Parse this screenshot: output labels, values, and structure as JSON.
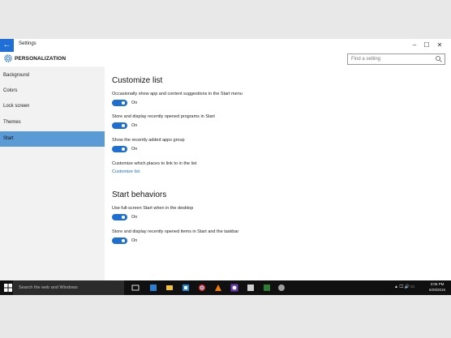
{
  "window": {
    "title": "Settings",
    "back_icon": "arrow-left-icon",
    "controls": [
      "–",
      "☐",
      "✕"
    ]
  },
  "header": {
    "section_title": "PERSONALIZATION",
    "icon": "gear-icon"
  },
  "search": {
    "placeholder": "Find a setting",
    "icon": "search-icon"
  },
  "sidebar": {
    "items": [
      {
        "label": "Background",
        "active": false
      },
      {
        "label": "Colors",
        "active": false
      },
      {
        "label": "Lock screen",
        "active": false
      },
      {
        "label": "Themes",
        "active": false
      },
      {
        "label": "Start",
        "active": true
      }
    ]
  },
  "main": {
    "customize_list": {
      "heading": "Customize list",
      "settings": [
        {
          "label": "Occasionally show app and content suggestions in the Start menu",
          "state": "On"
        },
        {
          "label": "Store and display recently opened programs in Start",
          "state": "On"
        },
        {
          "label": "Show the recently added apps group",
          "state": "On"
        }
      ],
      "places_label": "Customize which places to link to in the list",
      "link": "Customize list"
    },
    "start_behaviors": {
      "heading": "Start behaviors",
      "settings": [
        {
          "label": "Use full-screen Start when in the desktop",
          "state": "On"
        },
        {
          "label": "Store and display recently opened items in Start and the taskbar",
          "state": "On"
        }
      ]
    }
  },
  "taskbar": {
    "search_placeholder": "Search the web and Windows",
    "tray": "▲ 🖵 🔊 ▭",
    "time": "3:06 PM",
    "date": "6/29/2015"
  },
  "colors": {
    "accent": "#1e6fd0",
    "sidebar_active": "#5b9bd5",
    "taskbar": "#101010"
  }
}
